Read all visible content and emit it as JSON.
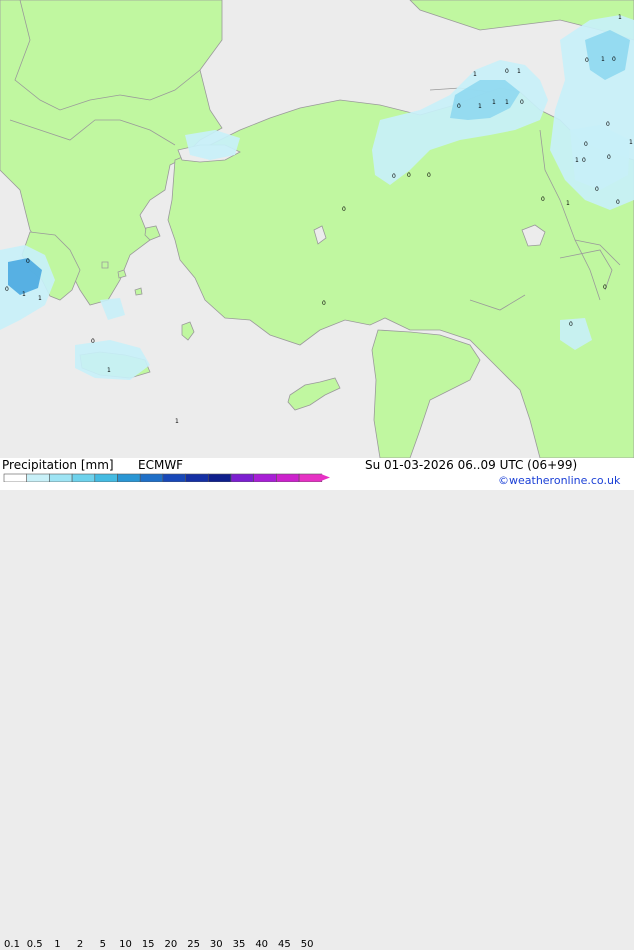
{
  "title": "Precipitation [mm]",
  "model": "ECMWF",
  "valid_time": "Su 01-03-2026 06..09 UTC (06+99)",
  "credit": "©weatheronline.co.uk",
  "colorbar": {
    "ticks": [
      "0.1",
      "0.5",
      "1",
      "2",
      "5",
      "10",
      "15",
      "20",
      "25",
      "30",
      "35",
      "40",
      "45",
      "50"
    ],
    "colors": [
      "#ffffff",
      "#c8f0f8",
      "#9ee4f4",
      "#6ed2ec",
      "#44bbe2",
      "#2a96d4",
      "#1f6fc7",
      "#1848b8",
      "#1530a4",
      "#0f1f8c",
      "#7c1fd0",
      "#a81fd6",
      "#cc22cc",
      "#e631c4"
    ]
  },
  "colors": {
    "land": "#c0f7a0",
    "sea": "#ececec",
    "coast": "#9a9a9a",
    "precip_light": "#c8f0f8",
    "precip_medium": "#8fd8f0",
    "precip_heavy": "#4aa8e0"
  },
  "point_labels": [
    "1",
    "0",
    "1",
    "1",
    "0",
    "1",
    "1",
    "0",
    "0",
    "1",
    "0",
    "1",
    "0",
    "0",
    "0",
    "0",
    "0",
    "1",
    "1",
    "0",
    "0",
    "0",
    "1",
    "1",
    "1",
    "0",
    "0",
    "0",
    "1",
    "0",
    "0",
    "0",
    "0",
    "1",
    "0",
    "0"
  ]
}
